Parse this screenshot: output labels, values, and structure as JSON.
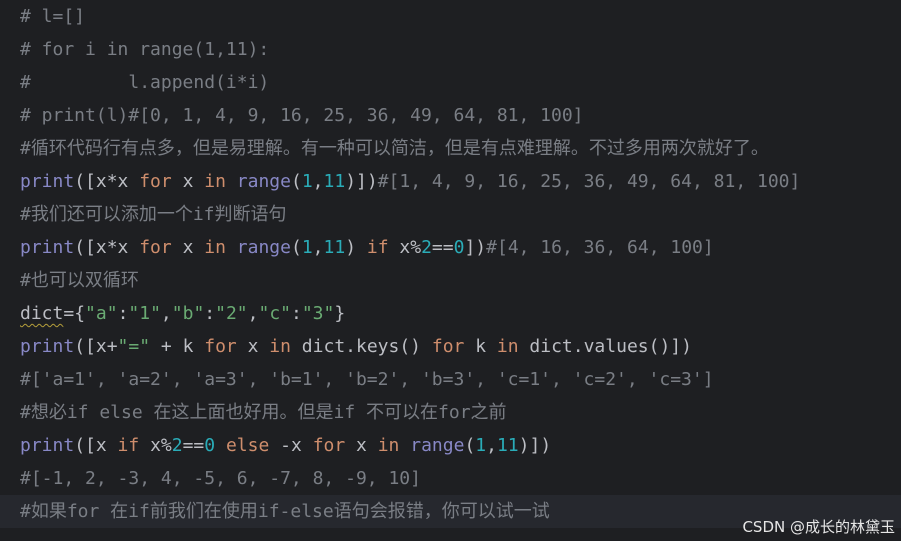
{
  "editor": {
    "lines": [
      [
        {
          "t": "# l=[]",
          "c": "comment"
        }
      ],
      [
        {
          "t": "# for i in range(1,11):",
          "c": "comment"
        }
      ],
      [
        {
          "t": "#         l.append(i*i)",
          "c": "comment"
        }
      ],
      [
        {
          "t": "# print(l)#[0, 1, 4, 9, 16, 25, 36, 49, 64, 81, 100]",
          "c": "comment"
        }
      ],
      [
        {
          "t": "#循环代码行有点多，但是易理解。有一种可以简洁，但是有点难理解。不过多用两次就好了。",
          "c": "comment"
        }
      ],
      [
        {
          "t": "print",
          "c": "builtin"
        },
        {
          "t": "([x*x ",
          "c": "plain"
        },
        {
          "t": "for",
          "c": "kw"
        },
        {
          "t": " x ",
          "c": "plain"
        },
        {
          "t": "in",
          "c": "kw"
        },
        {
          "t": " ",
          "c": "plain"
        },
        {
          "t": "range",
          "c": "builtin"
        },
        {
          "t": "(",
          "c": "plain"
        },
        {
          "t": "1",
          "c": "num"
        },
        {
          "t": ",",
          "c": "plain"
        },
        {
          "t": "11",
          "c": "num"
        },
        {
          "t": ")])",
          "c": "plain"
        },
        {
          "t": "#[1, 4, 9, 16, 25, 36, 49, 64, 81, 100]",
          "c": "comment"
        }
      ],
      [
        {
          "t": "#我们还可以添加一个if判断语句",
          "c": "comment"
        }
      ],
      [
        {
          "t": "print",
          "c": "builtin"
        },
        {
          "t": "([x*x ",
          "c": "plain"
        },
        {
          "t": "for",
          "c": "kw"
        },
        {
          "t": " x ",
          "c": "plain"
        },
        {
          "t": "in",
          "c": "kw"
        },
        {
          "t": " ",
          "c": "plain"
        },
        {
          "t": "range",
          "c": "builtin"
        },
        {
          "t": "(",
          "c": "plain"
        },
        {
          "t": "1",
          "c": "num"
        },
        {
          "t": ",",
          "c": "plain"
        },
        {
          "t": "11",
          "c": "num"
        },
        {
          "t": ") ",
          "c": "plain"
        },
        {
          "t": "if",
          "c": "kw"
        },
        {
          "t": " x%",
          "c": "plain"
        },
        {
          "t": "2",
          "c": "num"
        },
        {
          "t": "==",
          "c": "plain"
        },
        {
          "t": "0",
          "c": "num"
        },
        {
          "t": "])",
          "c": "plain"
        },
        {
          "t": "#[4, 16, 36, 64, 100]",
          "c": "comment"
        }
      ],
      [
        {
          "t": "#也可以双循环",
          "c": "comment"
        }
      ],
      [
        {
          "t": "dict",
          "c": "plain squiggle"
        },
        {
          "t": "={",
          "c": "plain"
        },
        {
          "t": "\"a\"",
          "c": "str"
        },
        {
          "t": ":",
          "c": "plain"
        },
        {
          "t": "\"1\"",
          "c": "str"
        },
        {
          "t": ",",
          "c": "plain"
        },
        {
          "t": "\"b\"",
          "c": "str"
        },
        {
          "t": ":",
          "c": "plain"
        },
        {
          "t": "\"2\"",
          "c": "str"
        },
        {
          "t": ",",
          "c": "plain"
        },
        {
          "t": "\"c\"",
          "c": "str"
        },
        {
          "t": ":",
          "c": "plain"
        },
        {
          "t": "\"3\"",
          "c": "str"
        },
        {
          "t": "}",
          "c": "plain"
        }
      ],
      [
        {
          "t": "print",
          "c": "builtin"
        },
        {
          "t": "([x+",
          "c": "plain"
        },
        {
          "t": "\"=\"",
          "c": "str"
        },
        {
          "t": " + k ",
          "c": "plain"
        },
        {
          "t": "for",
          "c": "kw"
        },
        {
          "t": " x ",
          "c": "plain"
        },
        {
          "t": "in",
          "c": "kw"
        },
        {
          "t": " dict.keys() ",
          "c": "plain"
        },
        {
          "t": "for",
          "c": "kw"
        },
        {
          "t": " k ",
          "c": "plain"
        },
        {
          "t": "in",
          "c": "kw"
        },
        {
          "t": " dict.values()])",
          "c": "plain"
        }
      ],
      [
        {
          "t": "#['a=1', 'a=2', 'a=3', 'b=1', 'b=2', 'b=3', 'c=1', 'c=2', 'c=3']",
          "c": "comment"
        }
      ],
      [
        {
          "t": "#想必if else 在这上面也好用。但是if 不可以在for之前",
          "c": "comment"
        }
      ],
      [
        {
          "t": "print",
          "c": "builtin"
        },
        {
          "t": "([x ",
          "c": "plain"
        },
        {
          "t": "if",
          "c": "kw"
        },
        {
          "t": " x%",
          "c": "plain"
        },
        {
          "t": "2",
          "c": "num"
        },
        {
          "t": "==",
          "c": "plain"
        },
        {
          "t": "0",
          "c": "num"
        },
        {
          "t": " ",
          "c": "plain"
        },
        {
          "t": "else",
          "c": "kw"
        },
        {
          "t": " -x ",
          "c": "plain"
        },
        {
          "t": "for",
          "c": "kw"
        },
        {
          "t": " x ",
          "c": "plain"
        },
        {
          "t": "in",
          "c": "kw"
        },
        {
          "t": " ",
          "c": "plain"
        },
        {
          "t": "range",
          "c": "builtin"
        },
        {
          "t": "(",
          "c": "plain"
        },
        {
          "t": "1",
          "c": "num"
        },
        {
          "t": ",",
          "c": "plain"
        },
        {
          "t": "11",
          "c": "num"
        },
        {
          "t": ")])",
          "c": "plain"
        }
      ],
      [
        {
          "t": "#[-1, 2, -3, 4, -5, 6, -7, 8, -9, 10]",
          "c": "comment"
        }
      ],
      [
        {
          "t": "#如果for 在if前我们在使用if-else语句会报错，你可以试一试",
          "c": "comment"
        }
      ]
    ],
    "current_line": 15,
    "colors": {
      "background": "#1e1f22",
      "current_line": "#26282e",
      "comment": "#7a7e85",
      "keyword": "#cf8e6d",
      "builtin": "#8888c6",
      "number": "#2aacb8",
      "string": "#6aab73",
      "text": "#bcbec4"
    }
  },
  "watermark": {
    "text": "CSDN @成长的林黛玉"
  }
}
